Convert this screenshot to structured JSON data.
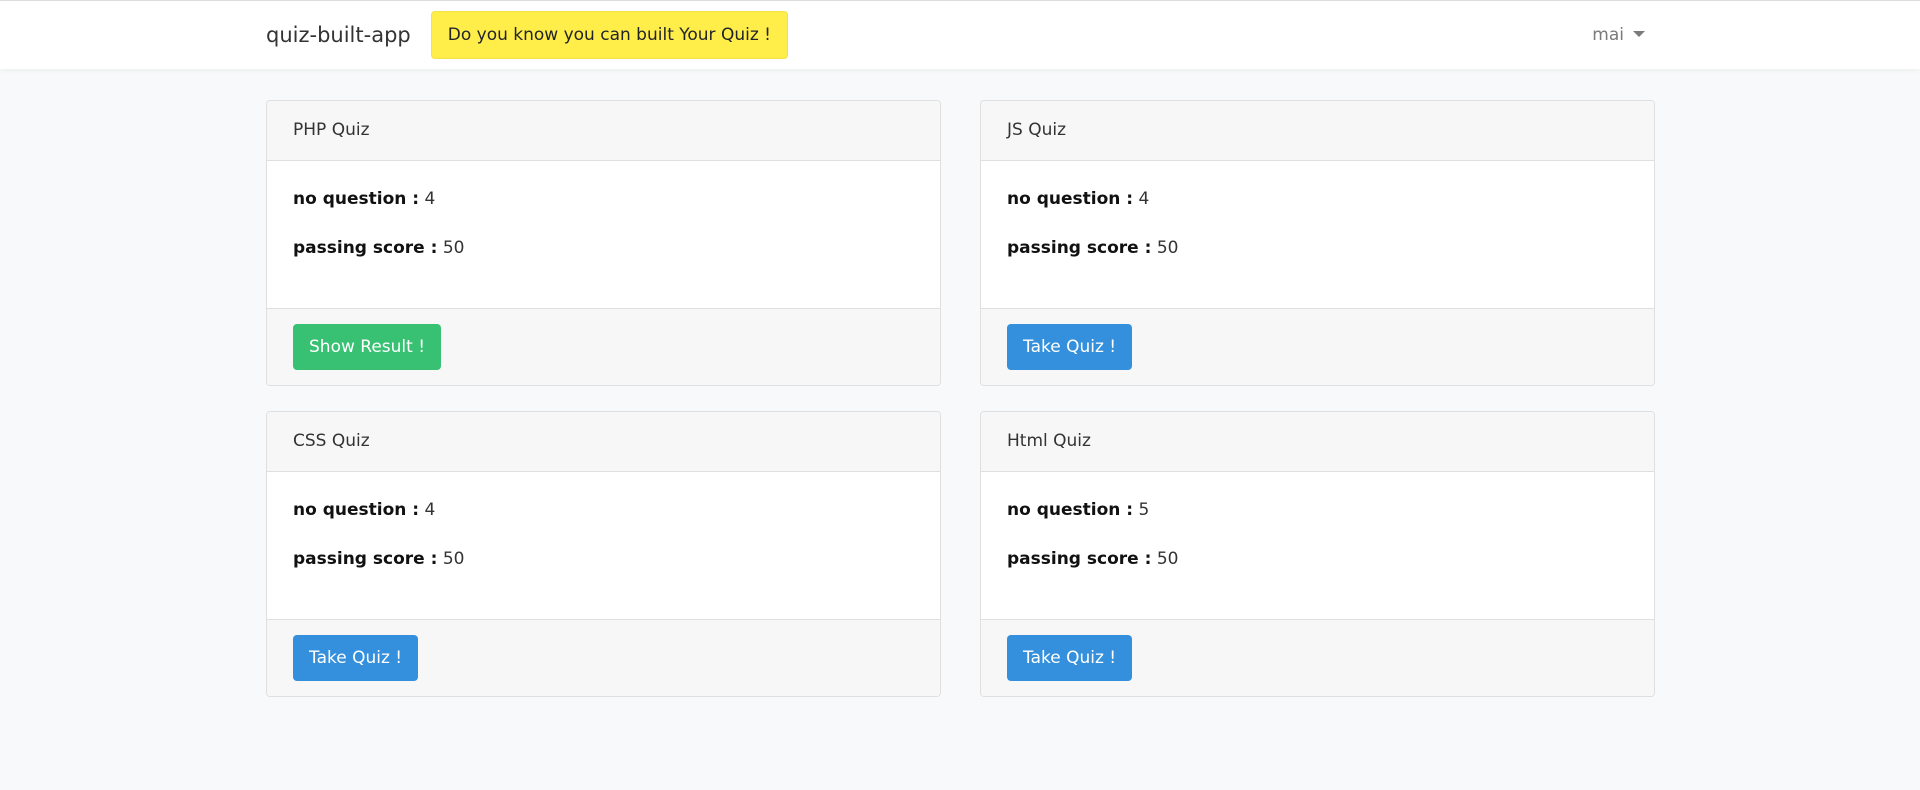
{
  "navbar": {
    "brand": "quiz-built-app",
    "promo": "Do you know you can built Your Quiz !",
    "user": "mai"
  },
  "quizzes": [
    {
      "title": "PHP Quiz",
      "questions_label": "no question :",
      "questions": "4",
      "score_label": "passing score :",
      "score": "50",
      "action": "Show Result !",
      "action_type": "success"
    },
    {
      "title": "JS Quiz",
      "questions_label": "no question :",
      "questions": "4",
      "score_label": "passing score :",
      "score": "50",
      "action": "Take Quiz !",
      "action_type": "primary"
    },
    {
      "title": "CSS Quiz",
      "questions_label": "no question :",
      "questions": "4",
      "score_label": "passing score :",
      "score": "50",
      "action": "Take Quiz !",
      "action_type": "primary"
    },
    {
      "title": "Html Quiz",
      "questions_label": "no question :",
      "questions": "5",
      "score_label": "passing score :",
      "score": "50",
      "action": "Take Quiz !",
      "action_type": "primary"
    }
  ],
  "colors": {
    "success": "#38c172",
    "primary": "#3490dc",
    "promo": "#ffed4a"
  }
}
